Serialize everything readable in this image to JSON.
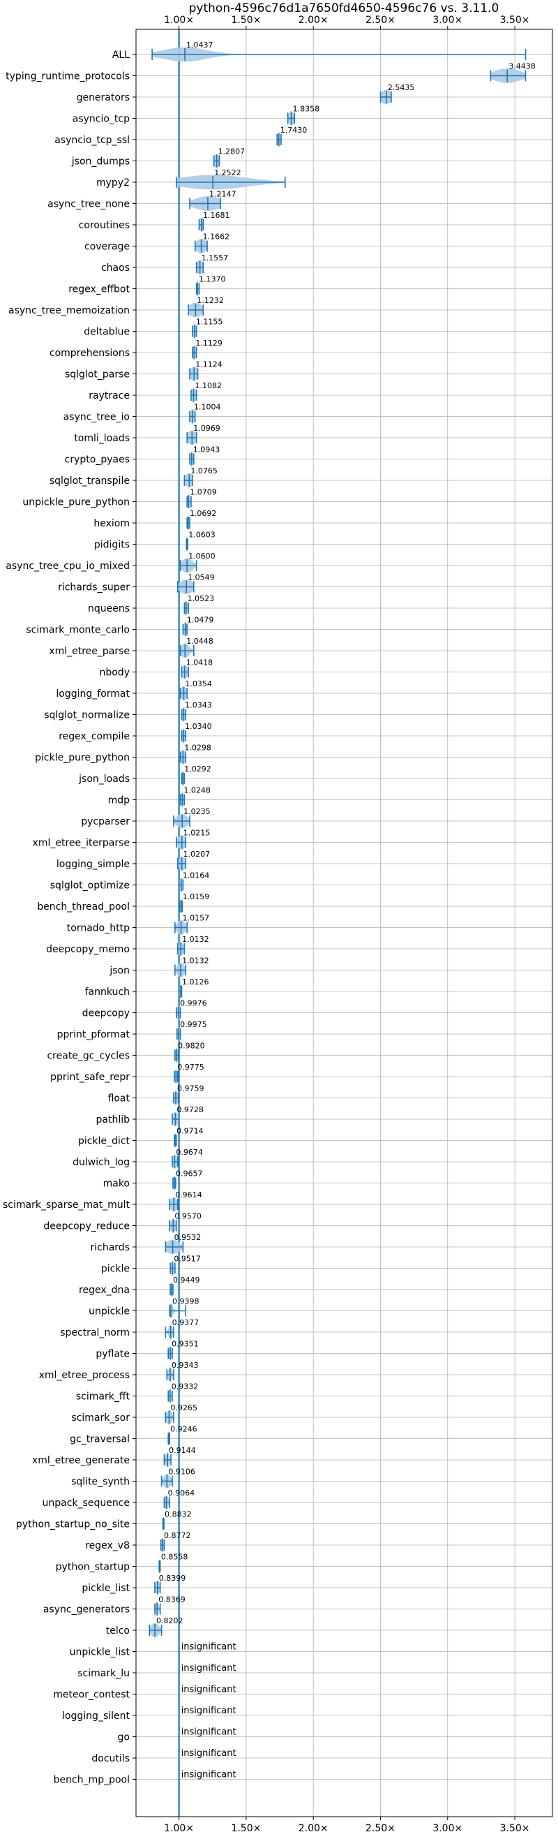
{
  "chart_data": {
    "type": "violin",
    "title": "python-4596c76d1a7650fd4650-4596c76 vs. 3.11.0",
    "xlabel": "",
    "ylabel": "",
    "x_scale": "linear",
    "xlim": [
      0.68,
      3.78
    ],
    "x_ticks": [
      1.0,
      1.5,
      2.0,
      2.5,
      3.0,
      3.5
    ],
    "x_tick_labels": [
      "1.00×",
      "1.50×",
      "2.00×",
      "2.50×",
      "3.00×",
      "3.50×"
    ],
    "x_ticks_on_top_and_bottom": true,
    "grid": true,
    "reference_line": 1.0,
    "series_color": "#1f77b4",
    "violin_fill_color": "#aacbe6",
    "benchmarks": [
      {
        "name": "ALL",
        "value": "1.0437",
        "mean": 1.0437,
        "min": 0.8,
        "max": 3.58,
        "spread": 0.16
      },
      {
        "name": "typing_runtime_protocols",
        "value": "3.4438",
        "mean": 3.4438,
        "min": 3.32,
        "max": 3.58,
        "spread": 0.1
      },
      {
        "name": "generators",
        "value": "2.5435",
        "mean": 2.5435,
        "min": 2.5,
        "max": 2.58,
        "spread": 0.04
      },
      {
        "name": "asyncio_tcp",
        "value": "1.8358",
        "mean": 1.8358,
        "min": 1.81,
        "max": 1.86,
        "spread": 0.02
      },
      {
        "name": "asyncio_tcp_ssl",
        "value": "1.7430",
        "mean": 1.743,
        "min": 1.73,
        "max": 1.76,
        "spread": 0.015
      },
      {
        "name": "json_dumps",
        "value": "1.2807",
        "mean": 1.2807,
        "min": 1.26,
        "max": 1.3,
        "spread": 0.02
      },
      {
        "name": "mypy2",
        "value": "1.2522",
        "mean": 1.2522,
        "min": 0.98,
        "max": 1.79,
        "spread": 0.25
      },
      {
        "name": "async_tree_none",
        "value": "1.2147",
        "mean": 1.2147,
        "min": 1.08,
        "max": 1.31,
        "spread": 0.1
      },
      {
        "name": "coroutines",
        "value": "1.1681",
        "mean": 1.1681,
        "min": 1.15,
        "max": 1.18,
        "spread": 0.015
      },
      {
        "name": "coverage",
        "value": "1.1662",
        "mean": 1.1662,
        "min": 1.12,
        "max": 1.21,
        "spread": 0.04
      },
      {
        "name": "chaos",
        "value": "1.1557",
        "mean": 1.1557,
        "min": 1.13,
        "max": 1.18,
        "spread": 0.025
      },
      {
        "name": "regex_effbot",
        "value": "1.1370",
        "mean": 1.137,
        "min": 1.13,
        "max": 1.15,
        "spread": 0.01
      },
      {
        "name": "async_tree_memoization",
        "value": "1.1232",
        "mean": 1.1232,
        "min": 1.07,
        "max": 1.18,
        "spread": 0.05
      },
      {
        "name": "deltablue",
        "value": "1.1155",
        "mean": 1.1155,
        "min": 1.1,
        "max": 1.13,
        "spread": 0.015
      },
      {
        "name": "comprehensions",
        "value": "1.1129",
        "mean": 1.1129,
        "min": 1.1,
        "max": 1.13,
        "spread": 0.015
      },
      {
        "name": "sqlglot_parse",
        "value": "1.1124",
        "mean": 1.1124,
        "min": 1.08,
        "max": 1.14,
        "spread": 0.03
      },
      {
        "name": "raytrace",
        "value": "1.1082",
        "mean": 1.1082,
        "min": 1.09,
        "max": 1.13,
        "spread": 0.02
      },
      {
        "name": "async_tree_io",
        "value": "1.1004",
        "mean": 1.1004,
        "min": 1.08,
        "max": 1.12,
        "spread": 0.02
      },
      {
        "name": "tomli_loads",
        "value": "1.0969",
        "mean": 1.0969,
        "min": 1.06,
        "max": 1.13,
        "spread": 0.035
      },
      {
        "name": "crypto_pyaes",
        "value": "1.0943",
        "mean": 1.0943,
        "min": 1.08,
        "max": 1.11,
        "spread": 0.015
      },
      {
        "name": "sqlglot_transpile",
        "value": "1.0765",
        "mean": 1.0765,
        "min": 1.04,
        "max": 1.1,
        "spread": 0.03
      },
      {
        "name": "unpickle_pure_python",
        "value": "1.0709",
        "mean": 1.0709,
        "min": 1.06,
        "max": 1.09,
        "spread": 0.015
      },
      {
        "name": "hexiom",
        "value": "1.0692",
        "mean": 1.0692,
        "min": 1.06,
        "max": 1.08,
        "spread": 0.01
      },
      {
        "name": "pidigits",
        "value": "1.0603",
        "mean": 1.0603,
        "min": 1.055,
        "max": 1.065,
        "spread": 0.005
      },
      {
        "name": "async_tree_cpu_io_mixed",
        "value": "1.0600",
        "mean": 1.06,
        "min": 1.01,
        "max": 1.13,
        "spread": 0.04
      },
      {
        "name": "richards_super",
        "value": "1.0549",
        "mean": 1.0549,
        "min": 0.99,
        "max": 1.11,
        "spread": 0.05
      },
      {
        "name": "nqueens",
        "value": "1.0523",
        "mean": 1.0523,
        "min": 1.04,
        "max": 1.07,
        "spread": 0.015
      },
      {
        "name": "scimark_monte_carlo",
        "value": "1.0479",
        "mean": 1.0479,
        "min": 1.03,
        "max": 1.06,
        "spread": 0.015
      },
      {
        "name": "xml_etree_parse",
        "value": "1.0448",
        "mean": 1.0448,
        "min": 1.01,
        "max": 1.11,
        "spread": 0.03
      },
      {
        "name": "nbody",
        "value": "1.0418",
        "mean": 1.0418,
        "min": 1.02,
        "max": 1.07,
        "spread": 0.02
      },
      {
        "name": "logging_format",
        "value": "1.0354",
        "mean": 1.0354,
        "min": 1.01,
        "max": 1.06,
        "spread": 0.02
      },
      {
        "name": "sqlglot_normalize",
        "value": "1.0343",
        "mean": 1.0343,
        "min": 1.02,
        "max": 1.05,
        "spread": 0.015
      },
      {
        "name": "regex_compile",
        "value": "1.0340",
        "mean": 1.034,
        "min": 1.02,
        "max": 1.05,
        "spread": 0.012
      },
      {
        "name": "pickle_pure_python",
        "value": "1.0298",
        "mean": 1.0298,
        "min": 1.01,
        "max": 1.05,
        "spread": 0.02
      },
      {
        "name": "json_loads",
        "value": "1.0292",
        "mean": 1.0292,
        "min": 1.02,
        "max": 1.04,
        "spread": 0.01
      },
      {
        "name": "mdp",
        "value": "1.0248",
        "mean": 1.0248,
        "min": 1.01,
        "max": 1.04,
        "spread": 0.012
      },
      {
        "name": "pycparser",
        "value": "1.0235",
        "mean": 1.0235,
        "min": 0.96,
        "max": 1.08,
        "spread": 0.04
      },
      {
        "name": "xml_etree_iterparse",
        "value": "1.0215",
        "mean": 1.0215,
        "min": 0.98,
        "max": 1.05,
        "spread": 0.03
      },
      {
        "name": "logging_simple",
        "value": "1.0207",
        "mean": 1.0207,
        "min": 0.99,
        "max": 1.05,
        "spread": 0.025
      },
      {
        "name": "sqlglot_optimize",
        "value": "1.0164",
        "mean": 1.0164,
        "min": 1.0,
        "max": 1.03,
        "spread": 0.012
      },
      {
        "name": "bench_thread_pool",
        "value": "1.0159",
        "mean": 1.0159,
        "min": 1.005,
        "max": 1.025,
        "spread": 0.01
      },
      {
        "name": "tornado_http",
        "value": "1.0157",
        "mean": 1.0157,
        "min": 0.97,
        "max": 1.06,
        "spread": 0.03
      },
      {
        "name": "deepcopy_memo",
        "value": "1.0132",
        "mean": 1.0132,
        "min": 0.99,
        "max": 1.04,
        "spread": 0.02
      },
      {
        "name": "json",
        "value": "1.0132",
        "mean": 1.0132,
        "min": 0.97,
        "max": 1.05,
        "spread": 0.025
      },
      {
        "name": "fannkuch",
        "value": "1.0126",
        "mean": 1.0126,
        "min": 1.0,
        "max": 1.02,
        "spread": 0.01
      },
      {
        "name": "deepcopy",
        "value": "0.9976",
        "mean": 0.9976,
        "min": 0.98,
        "max": 1.01,
        "spread": 0.012
      },
      {
        "name": "pprint_pformat",
        "value": "0.9975",
        "mean": 0.9975,
        "min": 0.985,
        "max": 1.01,
        "spread": 0.01
      },
      {
        "name": "create_gc_cycles",
        "value": "0.9820",
        "mean": 0.982,
        "min": 0.97,
        "max": 0.995,
        "spread": 0.01
      },
      {
        "name": "pprint_safe_repr",
        "value": "0.9775",
        "mean": 0.9775,
        "min": 0.965,
        "max": 0.99,
        "spread": 0.01
      },
      {
        "name": "float",
        "value": "0.9759",
        "mean": 0.9759,
        "min": 0.96,
        "max": 0.995,
        "spread": 0.015
      },
      {
        "name": "pathlib",
        "value": "0.9728",
        "mean": 0.9728,
        "min": 0.95,
        "max": 1.0,
        "spread": 0.02
      },
      {
        "name": "pickle_dict",
        "value": "0.9714",
        "mean": 0.9714,
        "min": 0.965,
        "max": 0.98,
        "spread": 0.006
      },
      {
        "name": "dulwich_log",
        "value": "0.9674",
        "mean": 0.9674,
        "min": 0.95,
        "max": 0.99,
        "spread": 0.015
      },
      {
        "name": "mako",
        "value": "0.9657",
        "mean": 0.9657,
        "min": 0.955,
        "max": 0.975,
        "spread": 0.008
      },
      {
        "name": "scimark_sparse_mat_mult",
        "value": "0.9614",
        "mean": 0.9614,
        "min": 0.93,
        "max": 0.99,
        "spread": 0.025
      },
      {
        "name": "deepcopy_reduce",
        "value": "0.9570",
        "mean": 0.957,
        "min": 0.93,
        "max": 0.98,
        "spread": 0.02
      },
      {
        "name": "richards",
        "value": "0.9532",
        "mean": 0.9532,
        "min": 0.9,
        "max": 1.03,
        "spread": 0.05
      },
      {
        "name": "pickle",
        "value": "0.9517",
        "mean": 0.9517,
        "min": 0.935,
        "max": 0.97,
        "spread": 0.012
      },
      {
        "name": "regex_dna",
        "value": "0.9449",
        "mean": 0.9449,
        "min": 0.935,
        "max": 0.955,
        "spread": 0.008
      },
      {
        "name": "unpickle",
        "value": "0.9398",
        "mean": 0.9398,
        "min": 0.93,
        "max": 1.05,
        "spread": 0.015
      },
      {
        "name": "spectral_norm",
        "value": "0.9377",
        "mean": 0.9377,
        "min": 0.9,
        "max": 0.96,
        "spread": 0.015
      },
      {
        "name": "pyflate",
        "value": "0.9351",
        "mean": 0.9351,
        "min": 0.92,
        "max": 0.95,
        "spread": 0.01
      },
      {
        "name": "xml_etree_process",
        "value": "0.9343",
        "mean": 0.9343,
        "min": 0.91,
        "max": 0.96,
        "spread": 0.015
      },
      {
        "name": "scimark_fft",
        "value": "0.9332",
        "mean": 0.9332,
        "min": 0.92,
        "max": 0.95,
        "spread": 0.01
      },
      {
        "name": "scimark_sor",
        "value": "0.9265",
        "mean": 0.9265,
        "min": 0.9,
        "max": 0.96,
        "spread": 0.02
      },
      {
        "name": "gc_traversal",
        "value": "0.9246",
        "mean": 0.9246,
        "min": 0.92,
        "max": 0.93,
        "spread": 0.004
      },
      {
        "name": "xml_etree_generate",
        "value": "0.9144",
        "mean": 0.9144,
        "min": 0.89,
        "max": 0.94,
        "spread": 0.015
      },
      {
        "name": "sqlite_synth",
        "value": "0.9106",
        "mean": 0.9106,
        "min": 0.87,
        "max": 0.95,
        "spread": 0.025
      },
      {
        "name": "unpack_sequence",
        "value": "0.9064",
        "mean": 0.9064,
        "min": 0.89,
        "max": 0.93,
        "spread": 0.012
      },
      {
        "name": "python_startup_no_site",
        "value": "0.8832",
        "mean": 0.8832,
        "min": 0.88,
        "max": 0.888,
        "spread": 0.003
      },
      {
        "name": "regex_v8",
        "value": "0.8772",
        "mean": 0.8772,
        "min": 0.865,
        "max": 0.89,
        "spread": 0.01
      },
      {
        "name": "python_startup",
        "value": "0.8558",
        "mean": 0.8558,
        "min": 0.852,
        "max": 0.86,
        "spread": 0.003
      },
      {
        "name": "pickle_list",
        "value": "0.8399",
        "mean": 0.8399,
        "min": 0.82,
        "max": 0.86,
        "spread": 0.015
      },
      {
        "name": "async_generators",
        "value": "0.8369",
        "mean": 0.8369,
        "min": 0.82,
        "max": 0.86,
        "spread": 0.012
      },
      {
        "name": "telco",
        "value": "0.8202",
        "mean": 0.8202,
        "min": 0.78,
        "max": 0.87,
        "spread": 0.03
      },
      {
        "name": "unpickle_list",
        "value": "insignificant",
        "insignificant": true
      },
      {
        "name": "scimark_lu",
        "value": "insignificant",
        "insignificant": true
      },
      {
        "name": "meteor_contest",
        "value": "insignificant",
        "insignificant": true
      },
      {
        "name": "logging_silent",
        "value": "insignificant",
        "insignificant": true
      },
      {
        "name": "go",
        "value": "insignificant",
        "insignificant": true
      },
      {
        "name": "docutils",
        "value": "insignificant",
        "insignificant": true
      },
      {
        "name": "bench_mp_pool",
        "value": "insignificant",
        "insignificant": true
      }
    ]
  }
}
